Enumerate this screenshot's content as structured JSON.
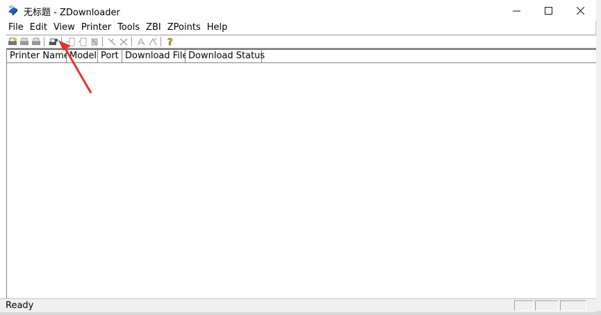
{
  "window": {
    "title": "无标题 - ZDownloader"
  },
  "menu": {
    "items": [
      {
        "label": "File",
        "id": "file"
      },
      {
        "label": "Edit",
        "id": "edit"
      },
      {
        "label": "View",
        "id": "view"
      },
      {
        "label": "Printer",
        "id": "printer"
      },
      {
        "label": "Tools",
        "id": "tools"
      },
      {
        "label": "ZBI",
        "id": "zbi"
      },
      {
        "label": "ZPoints",
        "id": "zpoints"
      },
      {
        "label": "Help",
        "id": "help"
      }
    ]
  },
  "toolbar": {
    "icons": [
      "new-printer-icon",
      "printer-settings-icon",
      "printer-remove-icon",
      "printer-connect-icon",
      "download-icon",
      "download-all-icon",
      "stop-icon",
      "tool-a-icon",
      "tool-b-icon",
      "tool-c-icon",
      "tool-d-icon",
      "help-icon"
    ]
  },
  "table": {
    "columns": [
      {
        "label": "Printer Name"
      },
      {
        "label": "Model"
      },
      {
        "label": "Port"
      },
      {
        "label": "Download File"
      },
      {
        "label": "Download Status"
      }
    ],
    "rows": []
  },
  "status": {
    "text": "Ready"
  },
  "colors": {
    "annotation_arrow": "#e8302a",
    "help_icon": "#e8c000"
  }
}
